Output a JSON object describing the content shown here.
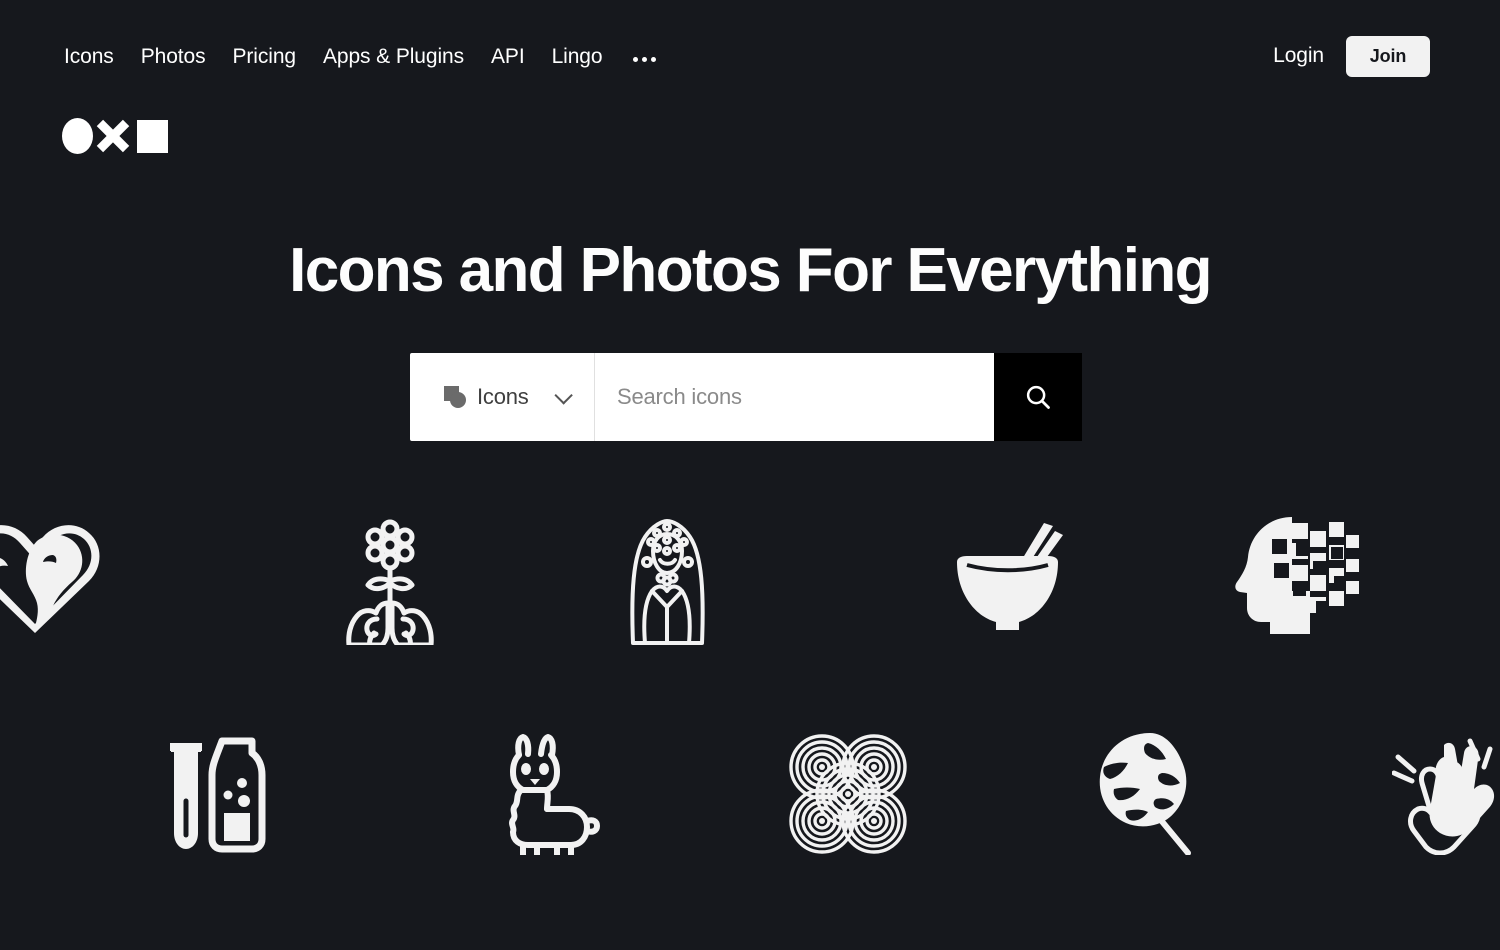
{
  "site": {
    "background_color": "#16181d",
    "accent_color": "#ffffff",
    "logo_name": "noun-project-logo"
  },
  "header": {
    "nav_items": [
      {
        "label": "Icons",
        "name": "nav-icons"
      },
      {
        "label": "Photos",
        "name": "nav-photos"
      },
      {
        "label": "Pricing",
        "name": "nav-pricing"
      },
      {
        "label": "Apps & Plugins",
        "name": "nav-apps-plugins"
      },
      {
        "label": "API",
        "name": "nav-api"
      },
      {
        "label": "Lingo",
        "name": "nav-lingo"
      }
    ],
    "more_menu": "…",
    "login_label": "Login",
    "join_label": "Join"
  },
  "hero": {
    "title": "Icons and Photos For Everything"
  },
  "search": {
    "type_label": "Icons",
    "type_icon": "noun-project-mini-icon",
    "chevron_icon": "chevron-down-icon",
    "placeholder": "Search icons",
    "value": "",
    "submit_icon": "search-icon"
  },
  "showcase": {
    "rows": [
      {
        "items": [
          {
            "name": "heart-faces-kissing-icon",
            "alt": "Heart with two faces kissing"
          },
          {
            "name": "lungs-flower-icon",
            "alt": "Lungs with a flower growing"
          },
          {
            "name": "bride-icon",
            "alt": "Bride wearing a veil"
          },
          {
            "name": "noodle-bowl-chopsticks-icon",
            "alt": "Bowl with chopsticks"
          },
          {
            "name": "pixelated-head-icon",
            "alt": "Head dissolving into pixels"
          }
        ]
      },
      {
        "items": [
          {
            "name": "test-tube-bottle-icon",
            "alt": "Test tube and potion bottle"
          },
          {
            "name": "llama-icon",
            "alt": "Llama standing"
          },
          {
            "name": "labyrinth-spiral-icon",
            "alt": "Interlocking concentric spirals"
          },
          {
            "name": "monstera-leaf-icon",
            "alt": "Monstera leaf"
          },
          {
            "name": "clapping-hands-icon",
            "alt": "Clapping hands"
          }
        ]
      }
    ]
  }
}
